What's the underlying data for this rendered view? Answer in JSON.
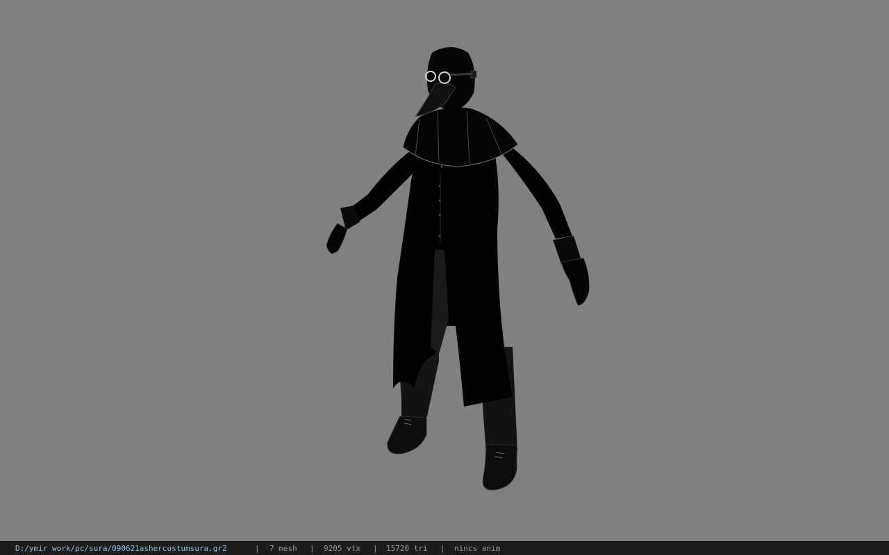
{
  "viewer": {
    "background_color": "#808080",
    "model": "plague-doctor-character"
  },
  "status": {
    "file_path": "D:/ymir work/pc/sura/090621ashercostumsura.gr2",
    "separator": "|",
    "mesh_count": "7 mesh",
    "vertex_count": "9205 vtx",
    "triangle_count": "15720 tri",
    "anim_status": "nincs anim"
  }
}
